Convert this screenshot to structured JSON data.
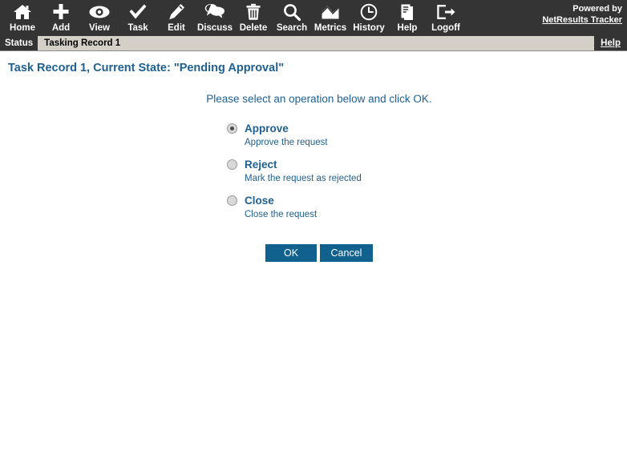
{
  "toolbar": {
    "items": [
      {
        "label": "Home",
        "icon": "home-icon"
      },
      {
        "label": "Add",
        "icon": "plus-icon"
      },
      {
        "label": "View",
        "icon": "eye-icon"
      },
      {
        "label": "Task",
        "icon": "check-icon"
      },
      {
        "label": "Edit",
        "icon": "pencil-icon"
      },
      {
        "label": "Discuss",
        "icon": "speech-bubbles-icon"
      },
      {
        "label": "Delete",
        "icon": "trash-icon"
      },
      {
        "label": "Search",
        "icon": "magnifier-icon"
      },
      {
        "label": "Metrics",
        "icon": "area-chart-icon"
      },
      {
        "label": "History",
        "icon": "clock-icon"
      },
      {
        "label": "Help",
        "icon": "document-icon"
      },
      {
        "label": "Logoff",
        "icon": "exit-icon"
      }
    ],
    "powered_by": "Powered by",
    "brand_link": "NetResults Tracker",
    "background_color": "#343434"
  },
  "statusbar": {
    "tab_label": "Status",
    "record_label": "Tasking Record 1",
    "help_label": "Help"
  },
  "page": {
    "title": "Task Record 1, Current State: \"Pending Approval\"",
    "instruction": "Please select an operation below and click OK.",
    "title_color": "#1f6092"
  },
  "options": [
    {
      "label": "Approve",
      "description": "Approve the request",
      "selected": true
    },
    {
      "label": "Reject",
      "description": "Mark the request as rejected",
      "selected": false
    },
    {
      "label": "Close",
      "description": "Close the request",
      "selected": false
    }
  ],
  "buttons": {
    "ok_label": "OK",
    "cancel_label": "Cancel",
    "button_color": "#11618f"
  }
}
